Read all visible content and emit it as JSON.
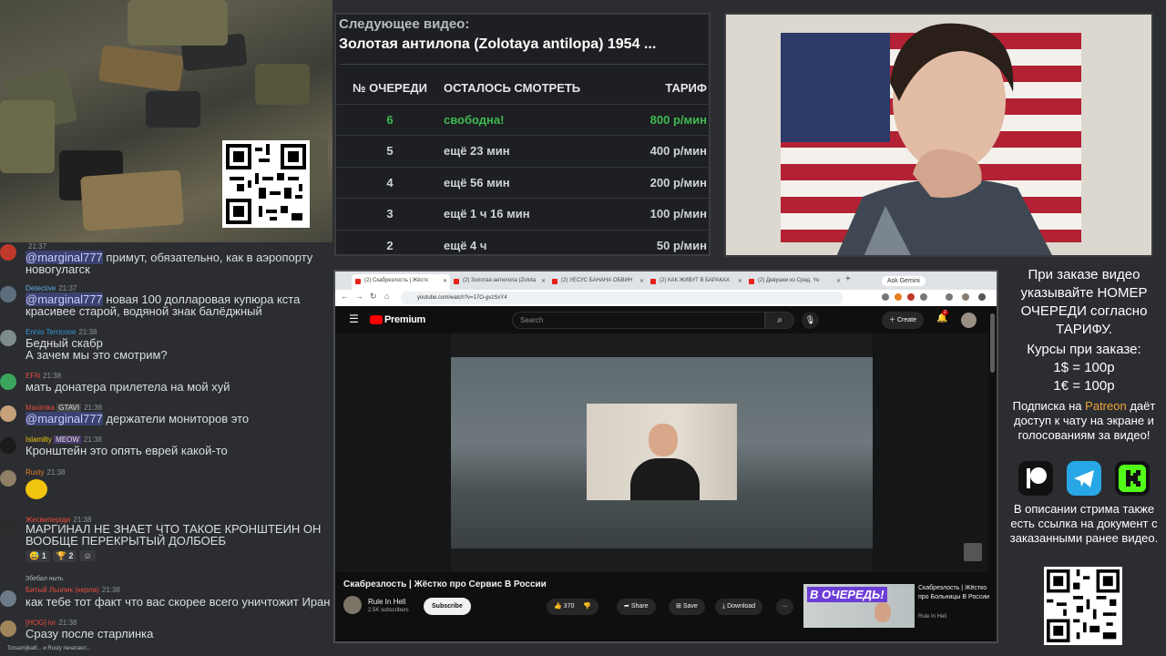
{
  "queue": {
    "next_label": "Следующее видео:",
    "next_title": "Золотая антилопа (Zolotaya antilopa) 1954 ...",
    "headers": [
      "№ ОЧЕРЕДИ",
      "ОСТАЛОСЬ СМОТРЕТЬ",
      "ТАРИФ"
    ],
    "rows": [
      {
        "num": "6",
        "remaining": "свободна!",
        "rate": "800 р/мин"
      },
      {
        "num": "5",
        "remaining": "ещё 23 мин",
        "rate": "400 р/мин"
      },
      {
        "num": "4",
        "remaining": "ещё 56 мин",
        "rate": "200 р/мин"
      },
      {
        "num": "3",
        "remaining": "ещё 1 ч 16 мин",
        "rate": "100 р/мин"
      },
      {
        "num": "2",
        "remaining": "ещё 4 ч",
        "rate": "50 р/мин"
      }
    ],
    "free_color": "#3fb950"
  },
  "chat": {
    "messages": [
      {
        "user": "",
        "time": "21:37",
        "text_mention": "@marginal777",
        "text": " примут, обязательно, как в аэропорту новогулагск"
      },
      {
        "user": "Detective",
        "time": "21:37",
        "text_mention": "@marginal777",
        "text": " новая 100 долларовая купюра кста красивее старой, водяной знак балёджный"
      },
      {
        "user": "Ennio Terricone",
        "time": "21:38",
        "text_mention": "",
        "text": "Бедный скабр\nА зачем мы это смотрим?"
      },
      {
        "user": "EFN",
        "time": "21:38",
        "text_mention": "",
        "text": "мать донатера прилетела на мой хуй"
      },
      {
        "user": "Maximka",
        "badge": "GTAVI",
        "time": "21:38",
        "text_mention": "@marginal777",
        "text": " держатели мониторов это"
      },
      {
        "user": "Islamilty",
        "badge": "MEOW",
        "time": "21:38",
        "text_mention": "",
        "text": "Кронштейн это опять еврей какой-то"
      },
      {
        "user": "Rusty",
        "time": "21:38",
        "text_mention": "",
        "text": ""
      },
      {
        "user": "Жесвиперідкі",
        "time": "21:38",
        "text_mention": "",
        "text": "МАРГИНАЛ НЕ ЗНАЕТ ЧТО ТАКОЕ КРОНШТЕИН ОН ВООБЩЕ ПЕРЕКРЫТЫЙ ДОЛБОЕБ"
      },
      {
        "user": "Битый Льопик (керла)",
        "reply": "Збебал ныть",
        "time": "21:38",
        "text_mention": "",
        "text": "как тебе тот факт что вас скорее всего уничтожит Иран"
      },
      {
        "user": "[HOG] ivr",
        "time": "21:38",
        "text_mention": "",
        "text": "Сразу после старлинка"
      }
    ],
    "reactions": [
      "1",
      "2"
    ],
    "typing": "Totsamijballl... и Rusty печатают..."
  },
  "browser": {
    "tabs": [
      "(2) Скабрезлость | Жёстк",
      "(2) Золотая антилопа (Zolota",
      "(2) УЕСУС БАНАНА ОБВИН",
      "(2) КАК ЖИВУТ В БАРАКАХ",
      "(2) Девушки из Сред. Yo"
    ],
    "ask_gemini": "Ask Gemini",
    "url": "youtube.com/watch?v=17O-gvzSxY4",
    "new_tab": "+"
  },
  "youtube": {
    "logo_text": "Premium",
    "search_placeholder": "Search",
    "create_label": "Create",
    "notif_count": "2",
    "video_title": "Скабрезлость | Жёстко про Сервис В России",
    "channel": "Rule In Hell",
    "subscribers": "2.5K subscribers",
    "subscribe_label": "Subscribe",
    "likes": "370",
    "share_label": "Share",
    "save_label": "Save",
    "download_label": "Download",
    "more_label": "···",
    "rec_badge": "В ОЧЕРЕДЬ!",
    "rec_title": "Скабрезлость | Жёстко про Больницы В России",
    "rec_channel": "Rule In Hell",
    "brand_red": "#ff0000"
  },
  "info": {
    "order_text": "При заказе видео указывайте НОМЕР ОЧЕРЕДИ согласно ТАРИФУ.",
    "rates_title": "Курсы при заказе:",
    "rate_usd": "1$ = 100р",
    "rate_eur": "1€ = 100р",
    "subscription_prefix": "Подписка на",
    "patreon_word": "Patreon",
    "subscription_rest": "даёт доступ к чату на экране и голосованиям за видео!",
    "description_text": "В описании стрима также есть ссылка на документ с заказанными ранее видео.",
    "socials": [
      "patreon-icon",
      "telegram-icon",
      "kick-icon"
    ],
    "patreon_color": "#f0a33a"
  }
}
